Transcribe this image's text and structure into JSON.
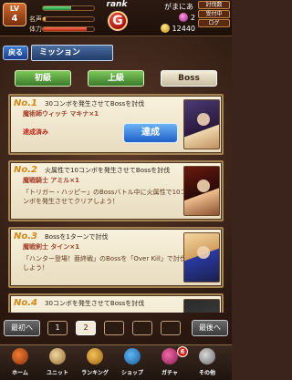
{
  "status": {
    "lv_label": "LV",
    "lv_value": "4",
    "fame_label": "名声",
    "stamina_label": "体力",
    "exp_fill": 0.55,
    "fame_fill": 0.05,
    "stamina_fill": 0.85,
    "rank_label": "rank",
    "rank_value": "G",
    "player_name": "がまにあ",
    "gems": "2",
    "coins": "12440",
    "side_badge_1": "討伐数",
    "side_badge_2": "受付中",
    "side_badge_3": "ログ"
  },
  "header": {
    "back_label": "戻る",
    "title": "ミッション"
  },
  "tabs": [
    {
      "label": "初級"
    },
    {
      "label": "上級"
    },
    {
      "label": "Boss"
    }
  ],
  "missions": [
    {
      "no": "No.1",
      "title": "30コンボを発生させてBossを討伐",
      "target": "魔術師ウィッチ マキナ×1",
      "achieved_text": "達成済み",
      "action_label": "達成"
    },
    {
      "no": "No.2",
      "title": "火属性で10コンボを発生させてBossを討伐",
      "target": "魔戦騎士 アミル×1",
      "desc": "「トリガー・ハッピー」のBossバトル中に火属性で10コンボを発生させてクリアしよう！"
    },
    {
      "no": "No.3",
      "title": "Bossを1ターンで討伐",
      "target": "魔戦剣士 タイン×1",
      "desc": "「ハンター登場！亜終戦」のBossを「Over Kill」で討伐しよう！"
    },
    {
      "no": "No.4",
      "title": "30コンボを発生させてBossを討伐"
    }
  ],
  "pager": {
    "first_label": "最初へ",
    "last_label": "最後へ",
    "pages": [
      "1",
      "2",
      "",
      "",
      ""
    ]
  },
  "nav": [
    {
      "label": "ホーム",
      "icon": "home-icon"
    },
    {
      "label": "ユニット",
      "icon": "unit-icon"
    },
    {
      "label": "ランキング",
      "icon": "ranking-icon"
    },
    {
      "label": "ショップ",
      "icon": "shop-icon"
    },
    {
      "label": "ガチャ",
      "icon": "gacha-icon",
      "badge": "6"
    },
    {
      "label": "その他",
      "icon": "other-icon"
    }
  ]
}
